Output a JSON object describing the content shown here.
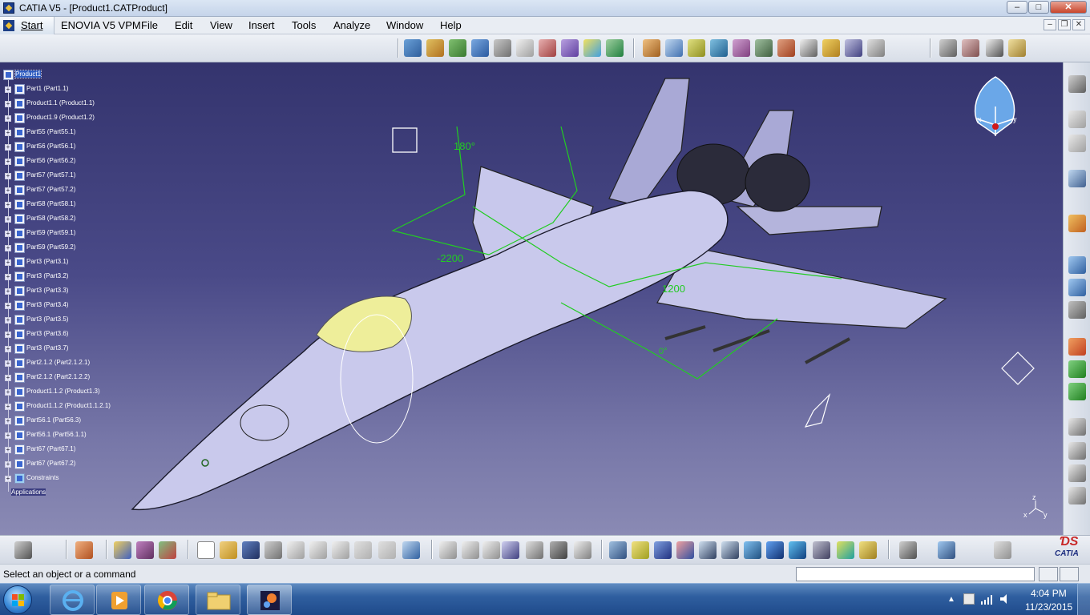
{
  "window": {
    "title": "CATIA V5 - [Product1.CATProduct]",
    "minimize": "–",
    "maximize": "□",
    "close": "✕"
  },
  "menu": {
    "start": "Start",
    "items": [
      "ENOVIA V5 VPM",
      "File",
      "Edit",
      "View",
      "Insert",
      "Tools",
      "Analyze",
      "Window",
      "Help"
    ]
  },
  "tree": {
    "root": "Product1",
    "items": [
      "Part1 (Part1.1)",
      "Product1.1 (Product1.1)",
      "Product1.9 (Product1.2)",
      "Part55 (Part55.1)",
      "Part56 (Part56.1)",
      "Part56 (Part56.2)",
      "Part57 (Part57.1)",
      "Part57 (Part57.2)",
      "Part58 (Part58.1)",
      "Part58 (Part58.2)",
      "Part59 (Part59.1)",
      "Part59 (Part59.2)",
      "Part3 (Part3.1)",
      "Part3 (Part3.2)",
      "Part3 (Part3.3)",
      "Part3 (Part3.4)",
      "Part3 (Part3.5)",
      "Part3 (Part3.6)",
      "Part3 (Part3.7)",
      "Part2.1.2 (Part2.1.2.1)",
      "Part2.1.2 (Part2.1.2.2)",
      "Product1.1.2 (Product1.3)",
      "Product1.1.2 (Product1.1.2.1)",
      "Part56.1 (Part56.3)",
      "Part56.1 (Part56.1.1)",
      "Part67 (Part67.1)",
      "Part67 (Part67.2)",
      "Constraints"
    ],
    "applications": "Applications"
  },
  "dimensions": {
    "angle_180": "180°",
    "len_2200": "-2200",
    "len_1200": "1200",
    "angle_0": "0°"
  },
  "compass": {
    "x": "x",
    "y": "y",
    "z": "z"
  },
  "axis": {
    "x": "x",
    "y": "y",
    "z": "z"
  },
  "status": {
    "message": "Select an object or a command",
    "command_value": ""
  },
  "logo": {
    "brand": "CATIA"
  },
  "taskbar": {
    "time": "4:04 PM",
    "date": "11/23/2015"
  },
  "colors": {
    "viewport_top": "#34346e",
    "viewport_bottom": "#8a8ab4",
    "dimension_green": "#22cc22",
    "aircraft_fill": "#c9c9ec"
  }
}
